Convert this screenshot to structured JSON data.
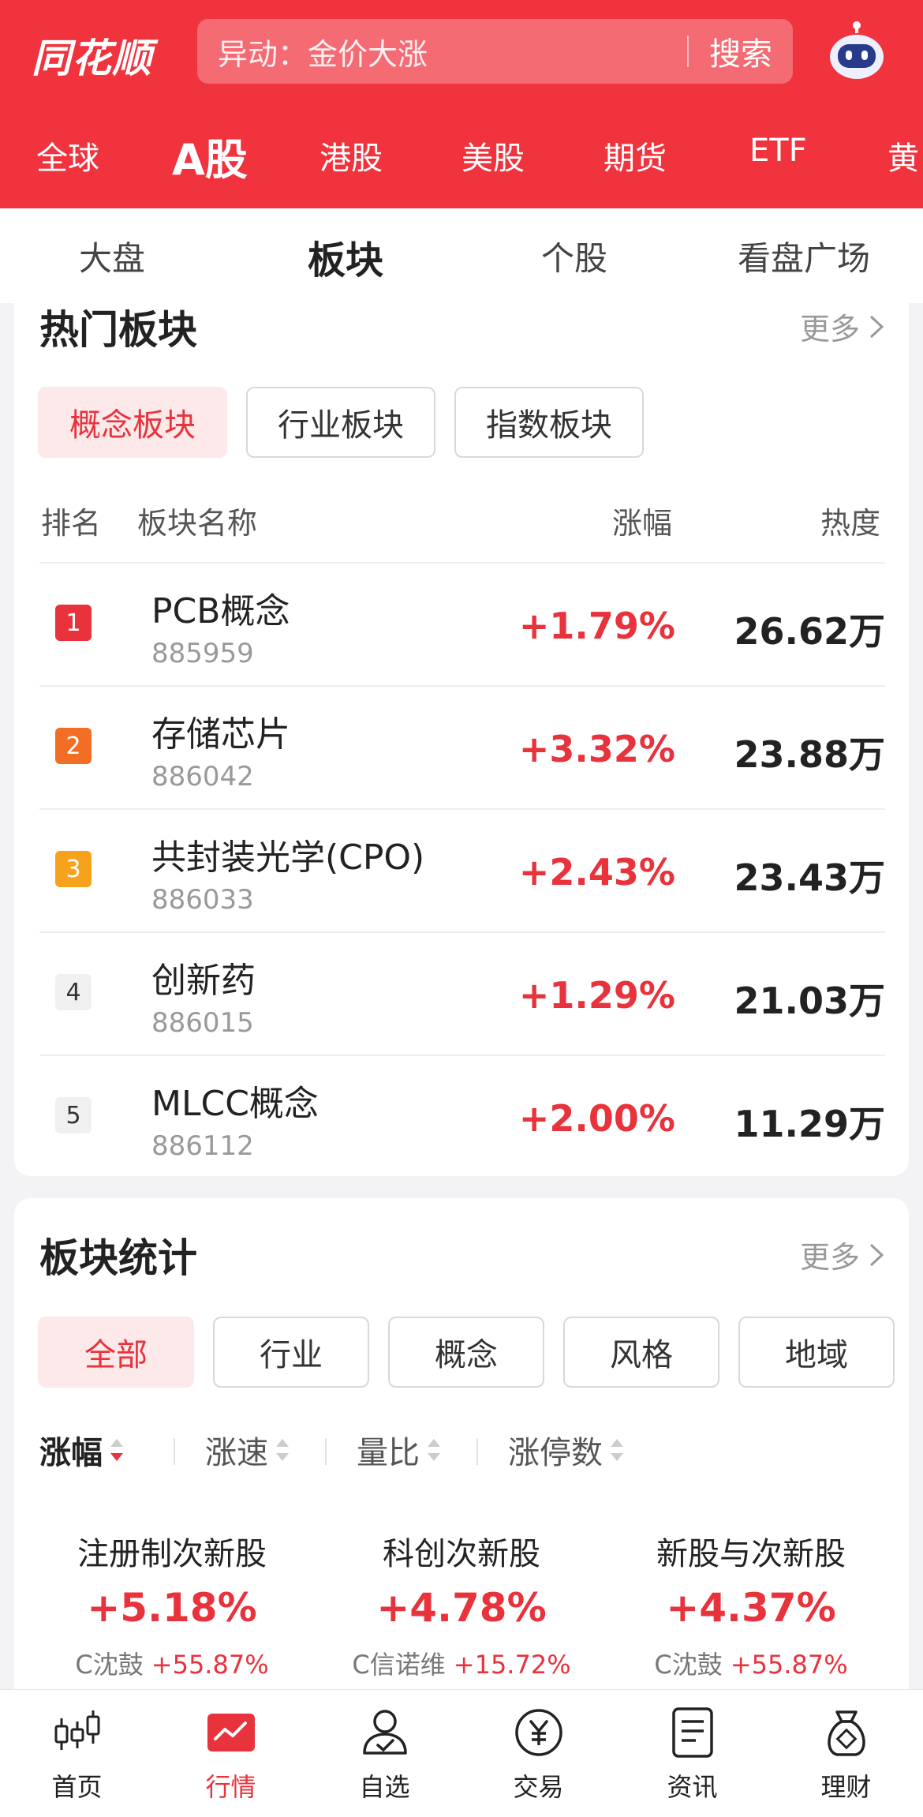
{
  "header": {
    "logo": "同花顺",
    "search_placeholder": "异动：金价大涨",
    "search_button": "搜索"
  },
  "market_tabs": [
    "全球",
    "A股",
    "港股",
    "美股",
    "期货",
    "ETF",
    "黄"
  ],
  "sub_tabs": [
    "大盘",
    "板块",
    "个股",
    "看盘广场"
  ],
  "hot_sectors": {
    "title": "热门板块",
    "more": "更多",
    "chips": [
      "概念板块",
      "行业板块",
      "指数板块"
    ],
    "columns": [
      "排名",
      "板块名称",
      "涨幅",
      "热度"
    ],
    "rows": [
      {
        "rank": "1",
        "name": "PCB概念",
        "code": "885959",
        "change": "+1.79%",
        "heat": "26.62万"
      },
      {
        "rank": "2",
        "name": "存储芯片",
        "code": "886042",
        "change": "+3.32%",
        "heat": "23.88万"
      },
      {
        "rank": "3",
        "name": "共封装光学(CPO)",
        "code": "886033",
        "change": "+2.43%",
        "heat": "23.43万"
      },
      {
        "rank": "4",
        "name": "创新药",
        "code": "886015",
        "change": "+1.29%",
        "heat": "21.03万"
      },
      {
        "rank": "5",
        "name": "MLCC概念",
        "code": "886112",
        "change": "+2.00%",
        "heat": "11.29万"
      }
    ]
  },
  "sector_stats": {
    "title": "板块统计",
    "more": "更多",
    "chips": [
      "全部",
      "行业",
      "概念",
      "风格",
      "地域"
    ],
    "sorts": [
      "涨幅",
      "涨速",
      "量比",
      "涨停数"
    ],
    "items": [
      {
        "name": "注册制次新股",
        "change": "+5.18%",
        "leader": "C沈鼓",
        "leader_change": "+55.87%"
      },
      {
        "name": "科创次新股",
        "change": "+4.78%",
        "leader": "C信诺维",
        "leader_change": "+15.72%"
      },
      {
        "name": "新股与次新股",
        "change": "+4.37%",
        "leader": "C沈鼓",
        "leader_change": "+55.87%"
      }
    ]
  },
  "bottom_nav": [
    "首页",
    "行情",
    "自选",
    "交易",
    "资讯",
    "理财"
  ],
  "colors": {
    "brand_red": "#f0333d",
    "up_red": "#e8323c",
    "rank2": "#f26e25",
    "rank3": "#f7a21b"
  }
}
